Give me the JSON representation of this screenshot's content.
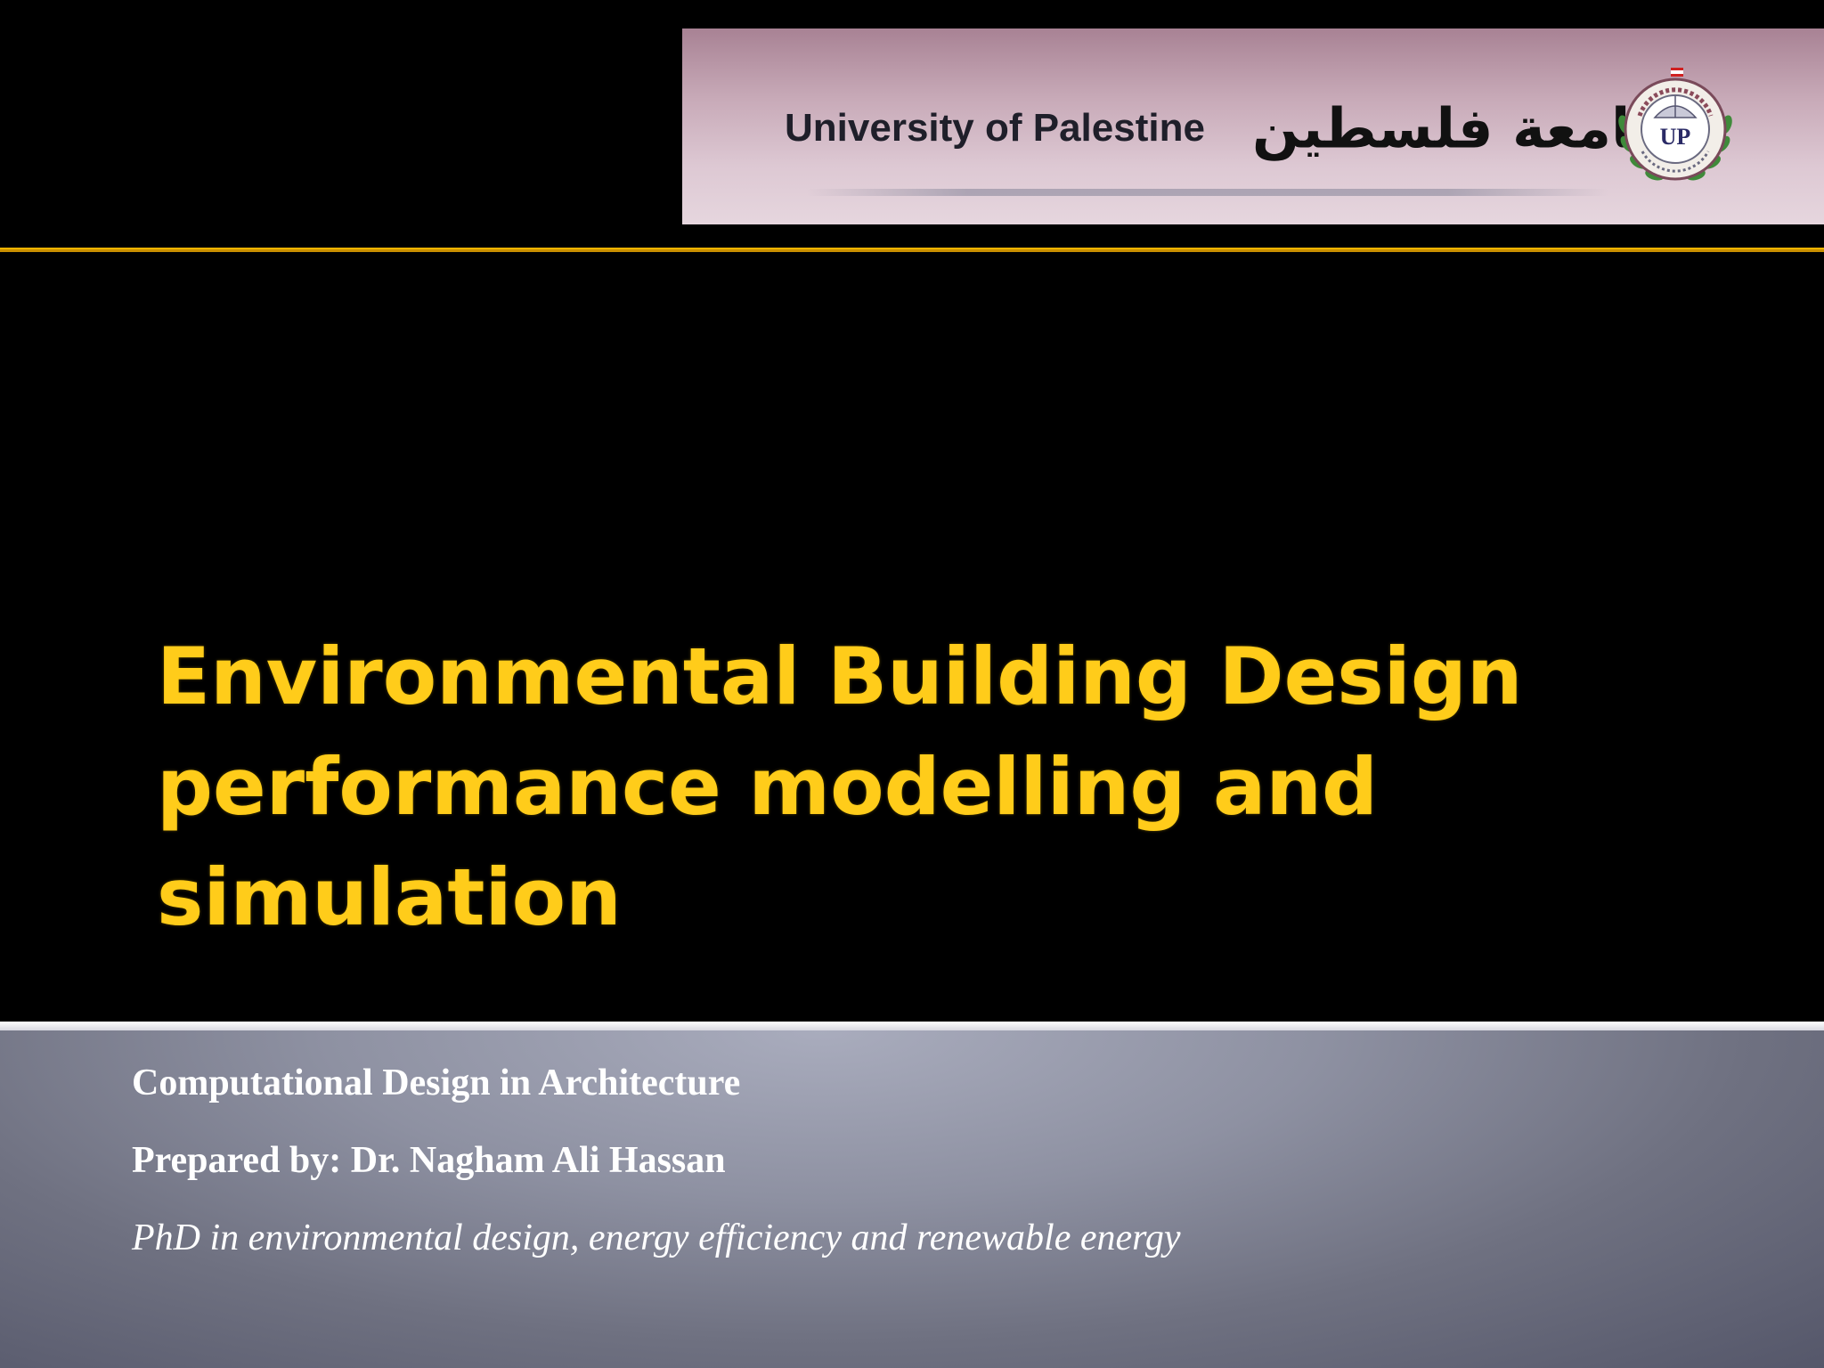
{
  "banner": {
    "university_en": "University of Palestine",
    "university_ar": "جامعة فلسطين",
    "logo_initials": "UP",
    "logo_ring_text": "جامعة فلسطين"
  },
  "title": {
    "line1": "Environmental Building Design",
    "line2": "performance modelling and",
    "line3": "simulation"
  },
  "subtitle": {
    "course": "Computational  Design in Architecture",
    "prepared_by": "Prepared by: Dr. Nagham Ali Hassan",
    "credentials": "PhD in environmental design, energy efficiency and renewable energy"
  },
  "colors": {
    "background": "#000000",
    "title": "#ffcc1a",
    "gold_line": "#f0b400",
    "subtitle_text": "#ffffff"
  }
}
